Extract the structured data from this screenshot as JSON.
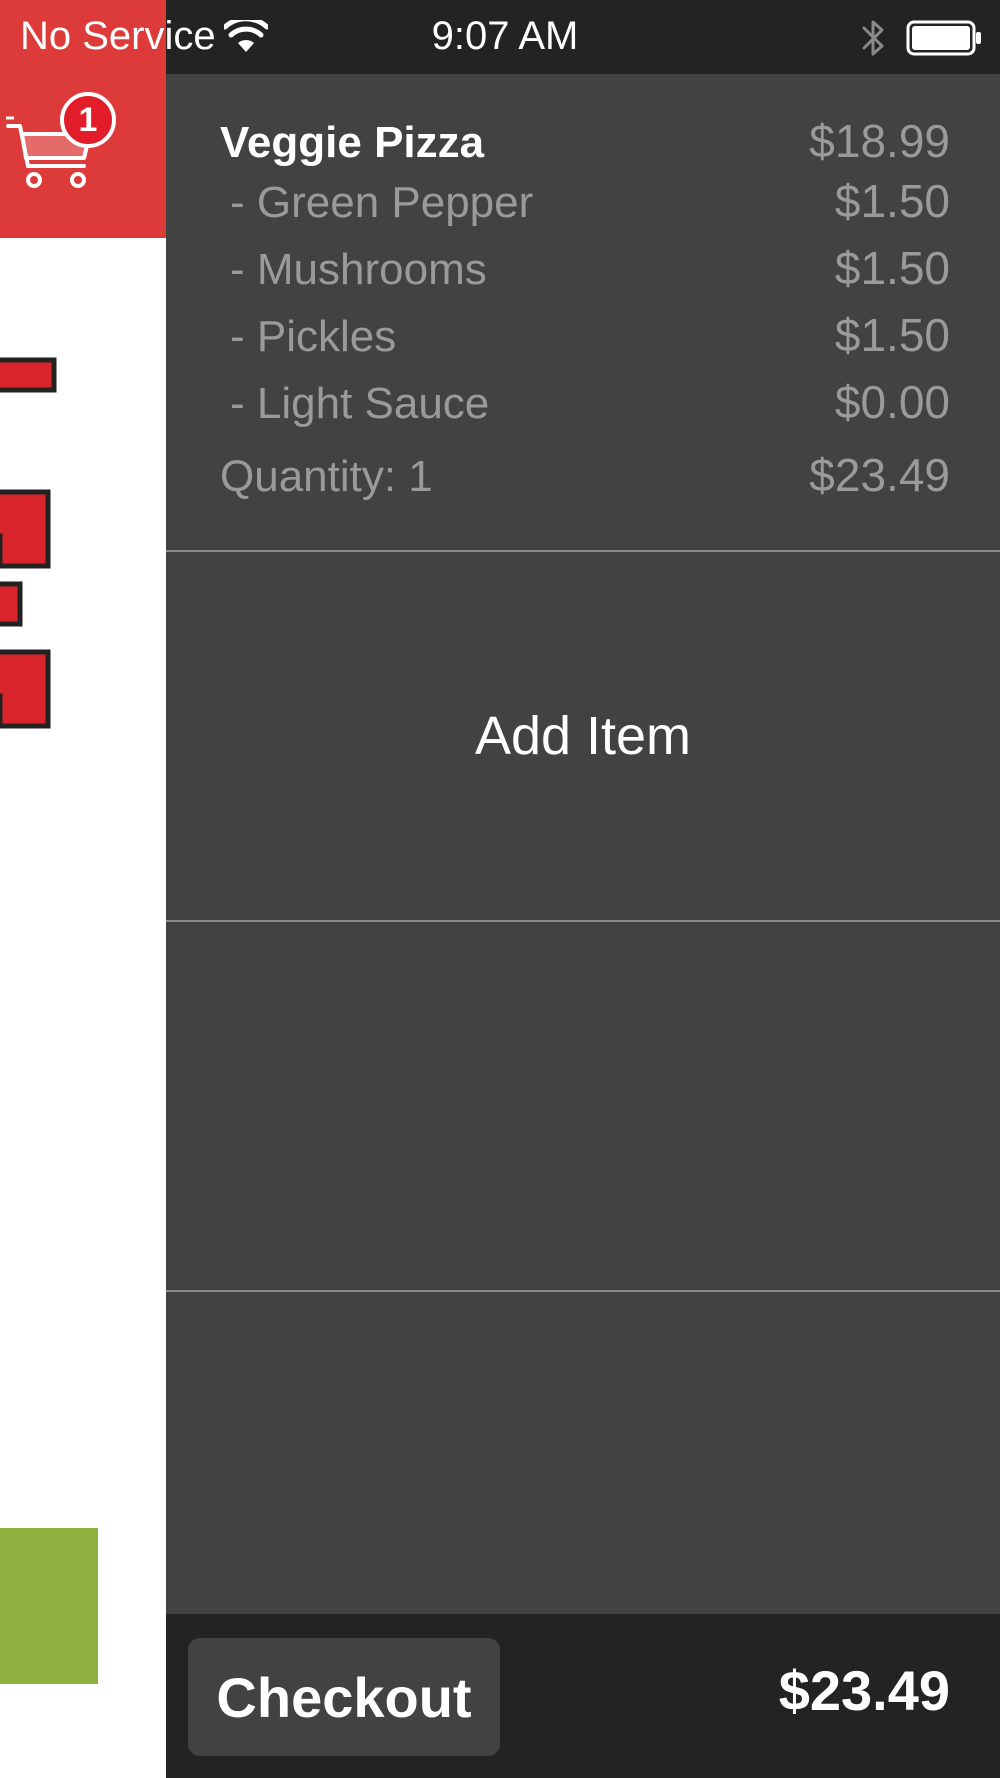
{
  "status_bar": {
    "carrier": "No Service",
    "time": "9:07 AM",
    "icons": [
      "wifi-icon",
      "bluetooth-icon",
      "battery-icon"
    ]
  },
  "sidebar": {
    "cart_badge_count": "1",
    "icon": "shopping-cart-icon",
    "colors": {
      "header": "#dd3a3a",
      "logo_red": "#d9252b",
      "green_block": "#8db03f"
    }
  },
  "cart": {
    "item": {
      "name": "Veggie Pizza",
      "price": "$18.99",
      "modifiers": [
        {
          "name": "- Green Pepper",
          "price": "$1.50"
        },
        {
          "name": "- Mushrooms",
          "price": "$1.50"
        },
        {
          "name": "- Pickles",
          "price": "$1.50"
        },
        {
          "name": "- Light Sauce",
          "price": "$0.00"
        }
      ],
      "quantity_label": "Quantity: 1",
      "subtotal": "$23.49"
    },
    "add_item_label": "Add Item",
    "colors": {
      "panel_bg": "#424242",
      "footer_bg": "#232323",
      "muted_text": "#9a9a9a"
    }
  },
  "footer": {
    "checkout_label": "Checkout",
    "total": "$23.49"
  }
}
